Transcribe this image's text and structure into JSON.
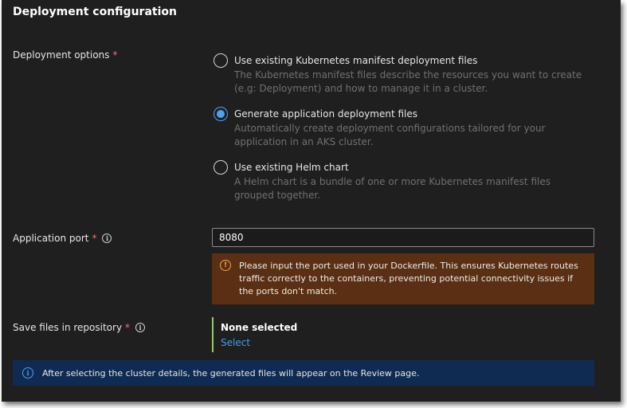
{
  "section": {
    "title": "Deployment configuration"
  },
  "deployment_options": {
    "label": "Deployment options",
    "required_mark": "*",
    "options": [
      {
        "label": "Use existing Kubernetes manifest deployment files",
        "description": "The Kubernetes manifest files describe the resources you want to create (e.g: Deployment) and how to manage it in a cluster.",
        "selected": false
      },
      {
        "label": "Generate application deployment files",
        "description": "Automatically create deployment configurations tailored for your application in an AKS cluster.",
        "selected": true
      },
      {
        "label": "Use existing Helm chart",
        "description": "A Helm chart is a bundle of one or more Kubernetes manifest files grouped together.",
        "selected": false
      }
    ]
  },
  "application_port": {
    "label": "Application port",
    "required_mark": "*",
    "info_icon": "i",
    "value": "8080",
    "warning_icon": "!",
    "warning": "Please input the port used in your Dockerfile. This ensures Kubernetes routes traffic correctly to the containers, preventing potential connectivity issues if the ports don't match."
  },
  "save_files": {
    "label": "Save files in repository",
    "required_mark": "*",
    "info_icon": "i",
    "status": "None selected",
    "select_link": "Select"
  },
  "info_bar": {
    "icon": "i",
    "text": "After selecting the cluster details, the generated files will appear on the Review page."
  },
  "colors": {
    "background": "#1f1f1f",
    "accent": "#4aa3f0",
    "required": "#f1707b",
    "warning_bg": "#5a2f13",
    "info_bg": "#0f2b52",
    "valid_bar": "#99c96a"
  }
}
